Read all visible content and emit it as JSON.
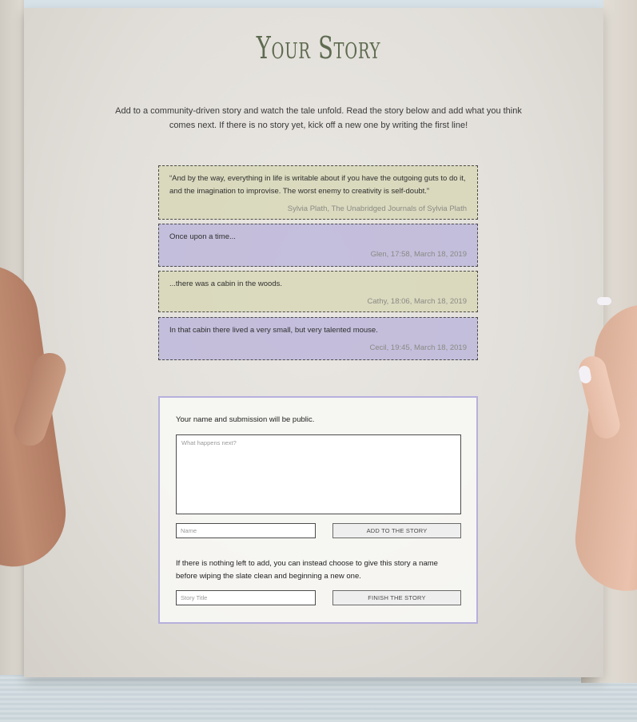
{
  "page": {
    "title": "Your Story",
    "intro": "Add to a community-driven story and watch the tale unfold. Read the story below and add what you think comes next. If there is no story yet, kick off a new one by writing the first line!"
  },
  "story": {
    "entries": [
      {
        "text": "“And by the way, everything in life is writable about if you have the outgoing guts to do it, and the imagination to improvise. The worst enemy to creativity is self-doubt.”",
        "meta": "Sylvia Plath, The Unabridged Journals of Sylvia Plath",
        "color": "#d6d6b2"
      },
      {
        "text": "Once upon a time...",
        "meta": "Glen, 17:58, March 18, 2019",
        "color": "#bab4da"
      },
      {
        "text": "...there was a cabin in the woods.",
        "meta": "Cathy, 18:06, March 18, 2019",
        "color": "#d6d6b2"
      },
      {
        "text": "In that cabin there lived a very small, but very talented mouse.",
        "meta": "Cecil, 19:45, March 18, 2019",
        "color": "#bab4da"
      }
    ]
  },
  "form": {
    "public_note": "Your name and submission will be public.",
    "next_placeholder": "What happens next?",
    "name_placeholder": "Name",
    "add_button": "ADD TO THE STORY",
    "finish_note": "If there is nothing left to add, you can instead choose to give this story a name before wiping the slate clean and beginning a new one.",
    "title_placeholder": "Story Title",
    "finish_button": "FINISH THE STORY"
  },
  "colors": {
    "title": "#5e6b50",
    "form_border": "#b7b0dc"
  }
}
